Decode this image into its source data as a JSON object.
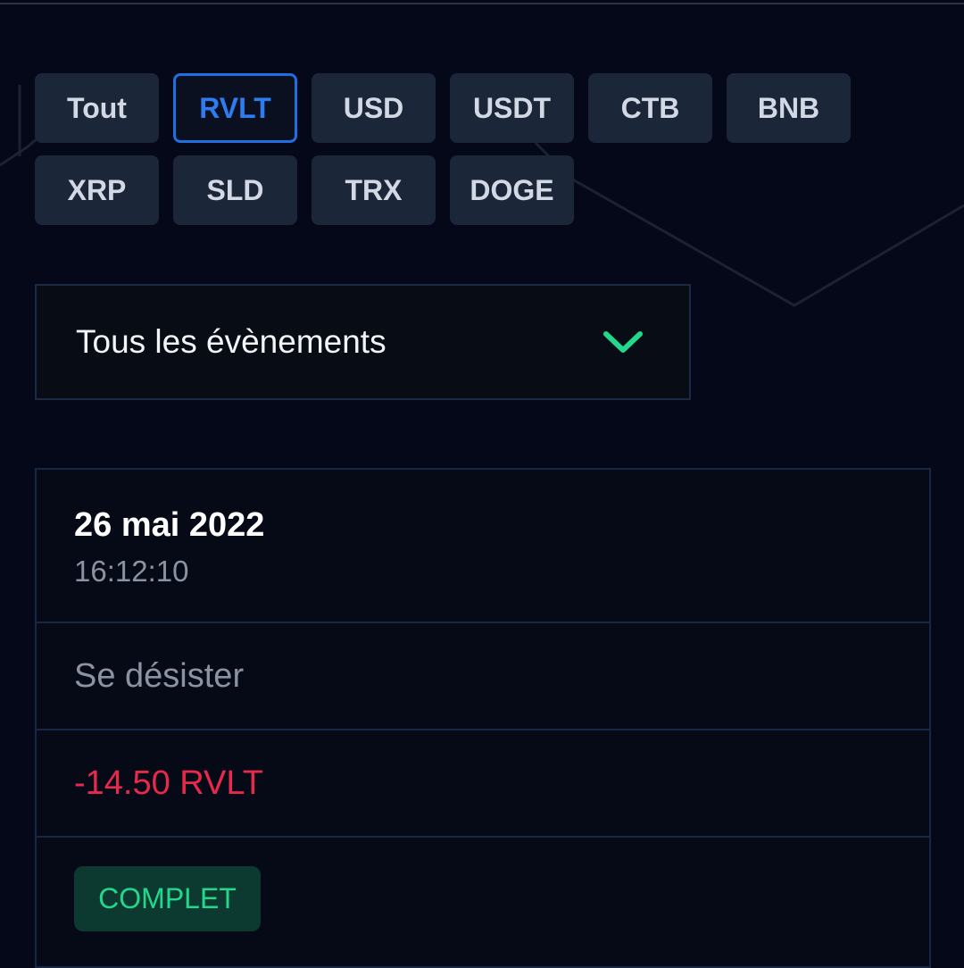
{
  "filters": {
    "items": [
      {
        "label": "Tout",
        "active": false
      },
      {
        "label": "RVLT",
        "active": true
      },
      {
        "label": "USD",
        "active": false
      },
      {
        "label": "USDT",
        "active": false
      },
      {
        "label": "CTB",
        "active": false
      },
      {
        "label": "BNB",
        "active": false
      },
      {
        "label": "XRP",
        "active": false
      },
      {
        "label": "SLD",
        "active": false
      },
      {
        "label": "TRX",
        "active": false
      },
      {
        "label": "DOGE",
        "active": false
      }
    ]
  },
  "event_select": {
    "selected": "Tous les évènements",
    "icon": "chevron-down-icon",
    "icon_color": "#22d88c"
  },
  "transaction": {
    "date": "26 mai 2022",
    "time": "16:12:10",
    "type": "Se désister",
    "amount": "-14.50 RVLT",
    "amount_color": "#e8284c",
    "status": "COMPLET",
    "status_color": "#22d88c"
  },
  "colors": {
    "background": "#050818",
    "chip": "#1b2639",
    "active_accent": "#1f6fe0"
  }
}
